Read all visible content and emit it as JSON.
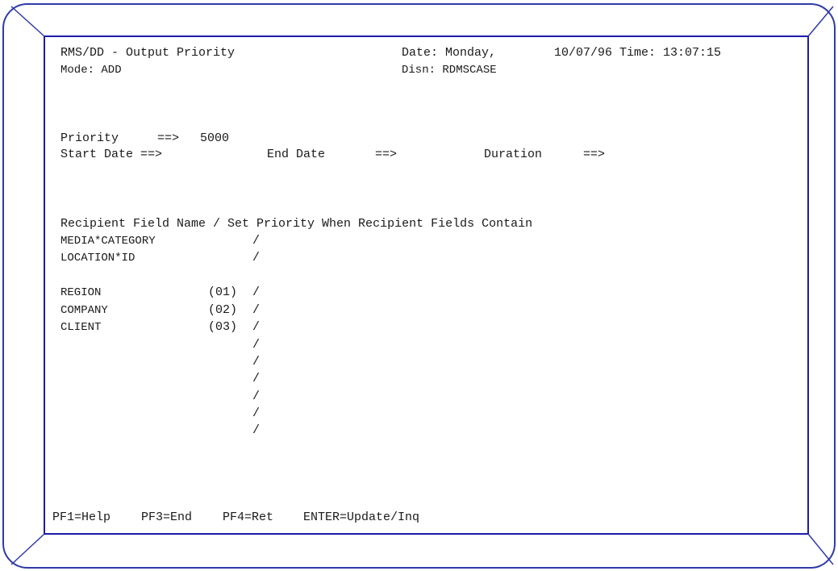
{
  "header": {
    "title": "RMS/DD - Output Priority",
    "date_label": "Date: Monday,",
    "date_time": "10/07/96 Time: 13:07:15",
    "mode": "Mode: ADD",
    "disn": "Disn: RDMSCASE"
  },
  "fields": {
    "priority_label": "Priority",
    "priority_arrow": "==>",
    "priority_value": "5000",
    "start_date_label": "Start Date ==>",
    "end_date_label": "End Date",
    "end_date_arrow": "==>",
    "duration_label": "Duration",
    "duration_arrow": "==>"
  },
  "recipient": {
    "heading": "Recipient Field Name / Set Priority When Recipient Fields Contain",
    "rows": [
      {
        "name": "MEDIA*CATEGORY",
        "num": ""
      },
      {
        "name": "LOCATION*ID",
        "num": ""
      },
      {
        "name": "REGION",
        "num": "(01)"
      },
      {
        "name": "COMPANY",
        "num": "(02)"
      },
      {
        "name": "CLIENT",
        "num": "(03)"
      }
    ],
    "separator": "/"
  },
  "footer": {
    "pf1": "PF1=Help",
    "pf3": "PF3=End",
    "pf4": "PF4=Ret",
    "enter": "ENTER=Update/Inq"
  }
}
